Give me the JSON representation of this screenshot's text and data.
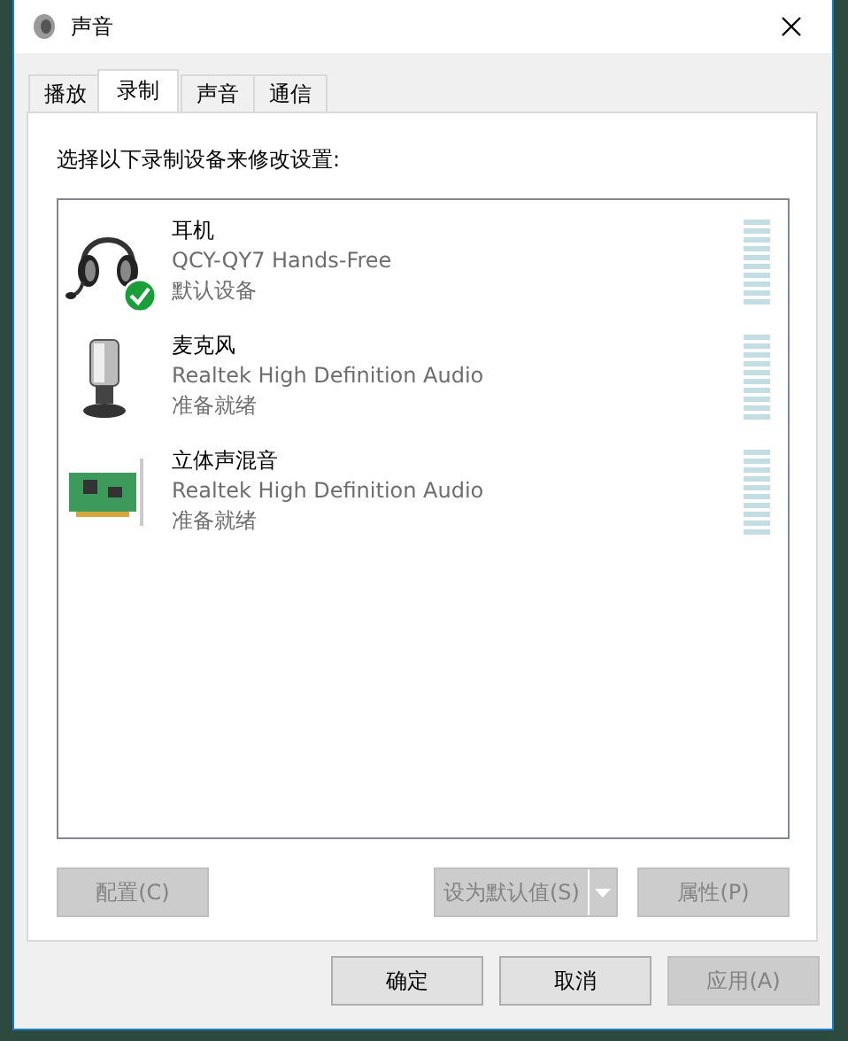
{
  "window": {
    "title": "声音"
  },
  "tabs": [
    {
      "label": "播放",
      "selected": false
    },
    {
      "label": "录制",
      "selected": true
    },
    {
      "label": "声音",
      "selected": false
    },
    {
      "label": "通信",
      "selected": false
    }
  ],
  "instruction": "选择以下录制设备来修改设置:",
  "devices": [
    {
      "kind": "headset",
      "name": "耳机",
      "description": "QCY-QY7 Hands-Free",
      "status": "默认设备",
      "default": true
    },
    {
      "kind": "microphone",
      "name": "麦克风",
      "description": "Realtek High Definition Audio",
      "status": "准备就绪",
      "default": false
    },
    {
      "kind": "soundcard",
      "name": "立体声混音",
      "description": "Realtek High Definition Audio",
      "status": "准备就绪",
      "default": false
    }
  ],
  "device_buttons": [
    {
      "kind": "plain",
      "label": "配置(C)",
      "disabled": true
    },
    {
      "kind": "split",
      "label": "设为默认值(S)",
      "disabled": true
    },
    {
      "kind": "plain",
      "label": "属性(P)",
      "disabled": true
    }
  ],
  "dialog_buttons": [
    {
      "label": "确定",
      "disabled": false
    },
    {
      "label": "取消",
      "disabled": false
    },
    {
      "label": "应用(A)",
      "disabled": true
    }
  ]
}
